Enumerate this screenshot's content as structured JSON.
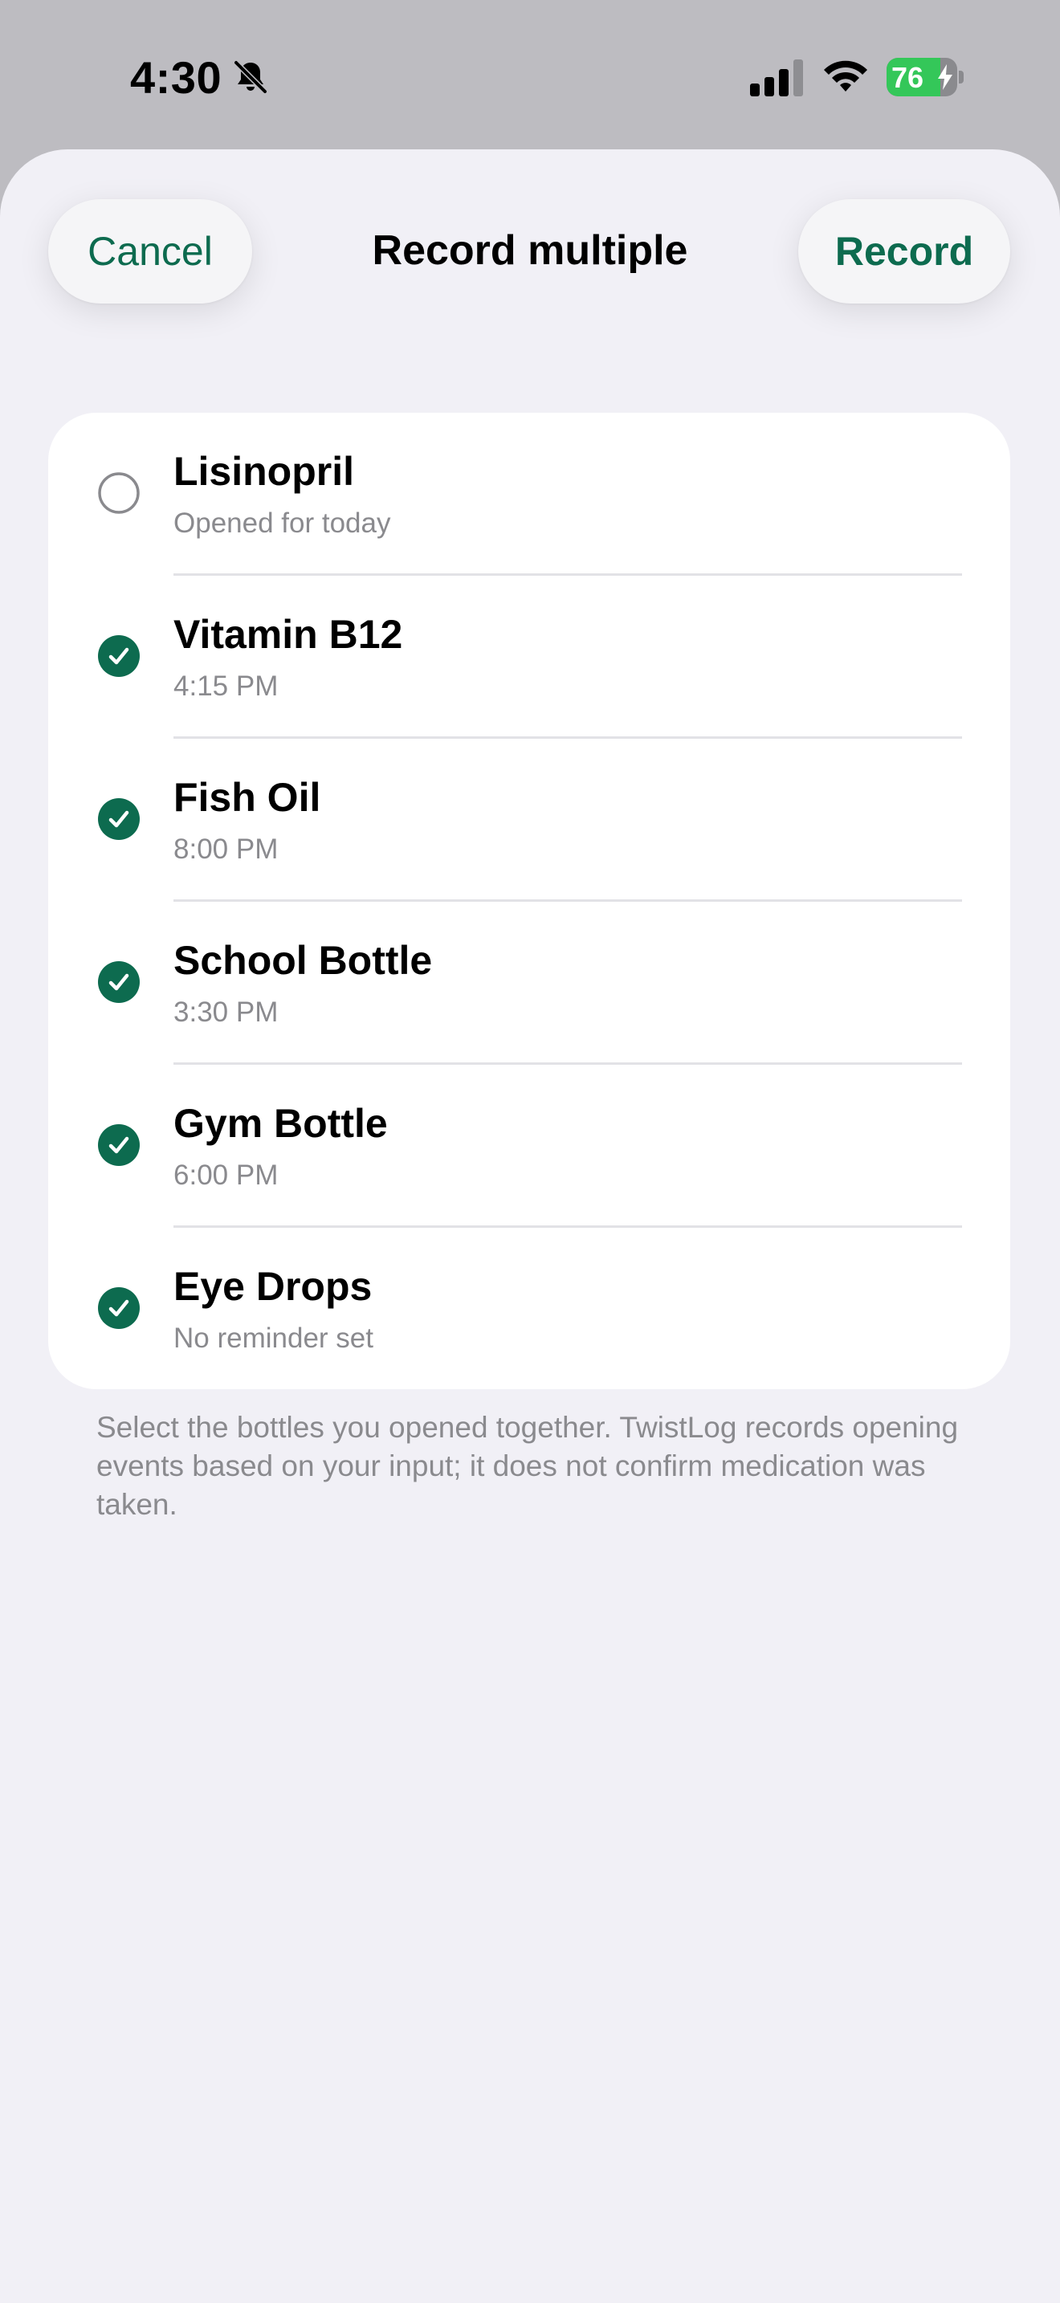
{
  "status_bar": {
    "time": "4:30",
    "battery_level": "76",
    "battery_fraction": 0.76
  },
  "header": {
    "cancel_label": "Cancel",
    "title": "Record multiple",
    "record_label": "Record"
  },
  "colors": {
    "accent": "#0d6b4f",
    "sheet_background": "#f1f0f6",
    "card_background": "#ffffff",
    "secondary_text": "#8a8a8e",
    "unchecked_circle": "#8a8a8e"
  },
  "bottles": [
    {
      "name": "Lisinopril",
      "detail": "Opened for today",
      "selected": false
    },
    {
      "name": "Vitamin B12",
      "detail": "4:15 PM",
      "selected": true
    },
    {
      "name": "Fish Oil",
      "detail": "8:00 PM",
      "selected": true
    },
    {
      "name": "School Bottle",
      "detail": "3:30 PM",
      "selected": true
    },
    {
      "name": "Gym Bottle",
      "detail": "6:00 PM",
      "selected": true
    },
    {
      "name": "Eye Drops",
      "detail": "No reminder set",
      "selected": true
    }
  ],
  "footer_note": "Select the bottles you opened together. TwistLog records opening events based on your input; it does not confirm medication was taken.",
  "icons": {
    "silent": "bell-slash-icon",
    "signal": "cellular-signal-icon",
    "wifi": "wifi-icon",
    "battery": "battery-charging-icon",
    "selected": "checkmark-circle-filled-icon",
    "unselected": "circle-outline-icon"
  }
}
